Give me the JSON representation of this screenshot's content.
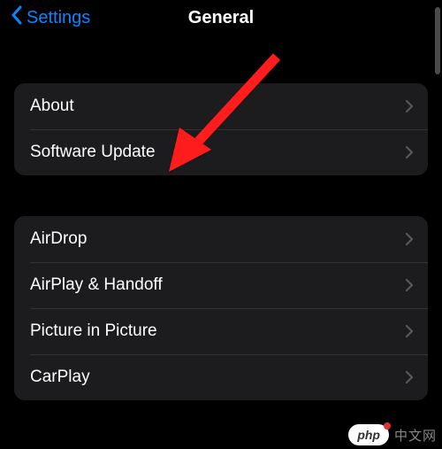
{
  "header": {
    "back_label": "Settings",
    "title": "General"
  },
  "groups": [
    {
      "items": [
        {
          "label": "About"
        },
        {
          "label": "Software Update"
        }
      ]
    },
    {
      "items": [
        {
          "label": "AirDrop"
        },
        {
          "label": "AirPlay & Handoff"
        },
        {
          "label": "Picture in Picture"
        },
        {
          "label": "CarPlay"
        }
      ]
    }
  ],
  "watermark": {
    "badge": "php",
    "text": "中文网"
  }
}
